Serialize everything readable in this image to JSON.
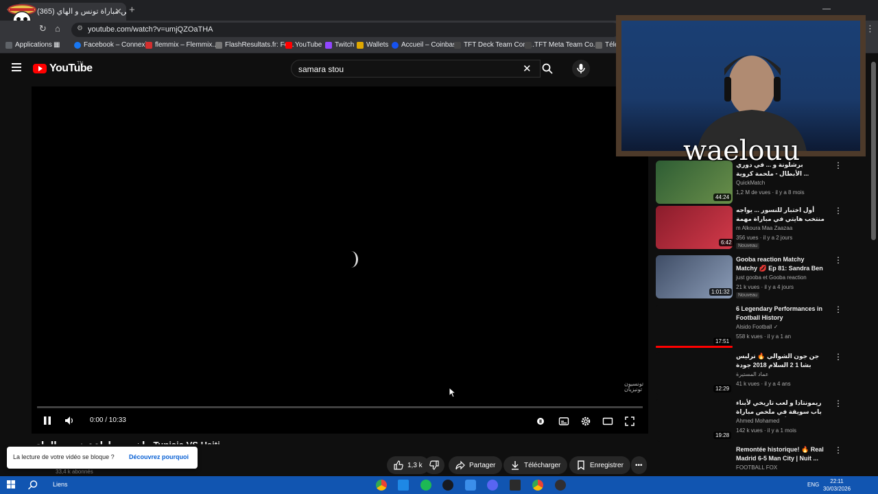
{
  "browser": {
    "tab_title": "(365) ملخص مباراة تونس و الهاي",
    "url": "youtube.com/watch?v=umjQZOaTHA",
    "bookmarks": [
      {
        "label": "Applications"
      },
      {
        "label": "Facebook – Connexi..."
      },
      {
        "label": "flemmix – Flemmix..."
      },
      {
        "label": "FlashResultats.fr: Fo..."
      },
      {
        "label": "YouTube"
      },
      {
        "label": "Twitch"
      },
      {
        "label": "Wallets"
      },
      {
        "label": "Accueil – Coinbase"
      },
      {
        "label": "TFT Deck Team Com..."
      },
      {
        "label": "TFT Meta Team Co..."
      },
      {
        "label": "Télé"
      }
    ]
  },
  "youtube": {
    "logo_text": "YouTube",
    "logo_tm": "TN",
    "search_query": "samara stou"
  },
  "player": {
    "time_display": "0:00 / 10:33",
    "watermark": "تونسيون تونيزيان",
    "progress": 0
  },
  "video": {
    "title": "ملخص مباراة تونس و الهاي Tunisia VS Haiti",
    "subscribers": "33,4 k abonnés",
    "likes": "1,3 k",
    "share_label": "Partager",
    "download_label": "Télécharger",
    "save_label": "Enregistrer"
  },
  "popup": {
    "question": "La lecture de votre vidéo se bloque ?",
    "link": "Découvrez pourquoi"
  },
  "recommendations": [
    {
      "title": "برشلونة و ... في دوري الأبطال - ملحمة كروية ...",
      "channel": "QuickMatch",
      "meta": "1,2 M de vues · il y a 8 mois",
      "duration": "44:24",
      "badge": "",
      "thumb": "#3b6b3f"
    },
    {
      "title": "أول اختبار للنسور ... يواجه منتخب هايتي في مباراة مهمة لقيس ...",
      "channel": "m Alkoura Maa Zaazaa",
      "meta": "356 vues · il y a 2 jours",
      "duration": "6:42",
      "badge": "Nouveau",
      "thumb": "#b3283a"
    },
    {
      "title": "Gooba reaction Matchy Matchy 💋 Ep 81: Sandra Ben Othman...",
      "channel": "just gooba et Gooba reaction",
      "meta": "21 k vues · il y a 4 jours",
      "duration": "1:01:32",
      "badge": "Nouveau",
      "thumb": "#5c6f8c"
    },
    {
      "title": "6 Legendary Performances in Football History",
      "channel": "Alsido Football ✓",
      "meta": "558 k vues · il y a 1 an",
      "duration": "17:51",
      "badge": "",
      "thumb": "#0f0f0f"
    },
    {
      "title": "جن جون الشوالي 🔥 ترليس بشا 1 2 السلام 2018 جودة عالية 1080i تعليق",
      "channel": "عماد المستيرة",
      "meta": "41 k vues · il y a 4 ans",
      "duration": "12:29",
      "badge": "",
      "thumb": "#0f0f0f"
    },
    {
      "title": "ريمونتادا و لعب تاريخي لأبناء باب سويقة في ملخص مباراة الترجي و الأهلي ذهاب دوري ...",
      "channel": "Ahmed Mohamed",
      "meta": "142 k vues · il y a 1 mois",
      "duration": "19:28",
      "badge": "",
      "thumb": "#0f0f0f"
    },
    {
      "title": "Remontée historique! 🔥 Real Madrid 6-5 Man City | Nuit ...",
      "channel": "FOOTBALL FOX",
      "meta": "",
      "duration": "",
      "badge": "",
      "thumb": "#0f0f0f"
    }
  ],
  "webcam": {
    "name": "waelouu"
  },
  "taskbar": {
    "links_label": "Liens",
    "lang": "ENG",
    "time": "22:11",
    "date": "30/03/2026"
  },
  "colors": {
    "yt_red": "#ff0000",
    "taskbar": "#1155b1",
    "link_blue": "#065fd4"
  }
}
